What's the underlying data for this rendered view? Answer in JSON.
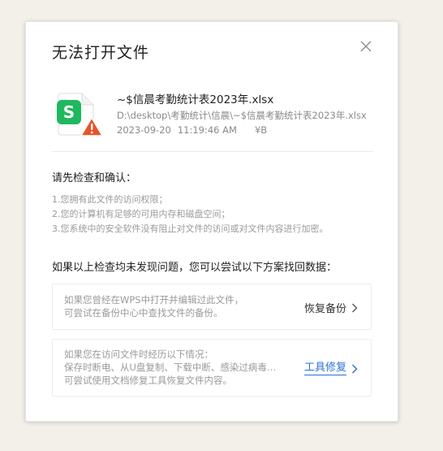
{
  "dialog": {
    "title": "无法打开文件"
  },
  "file": {
    "name": "~$信晨考勤统计表2023年.xlsx",
    "path": "D:\\desktop\\考勤统计\\信晨\\~$信晨考勤统计表2023年.xlsx",
    "date": "2023-09-20",
    "time": "11:19:46 AM",
    "size": "¥B",
    "app_letter": "S"
  },
  "checks": {
    "heading": "请先检查和确认：",
    "items": [
      "1.您拥有此文件的访问权限；",
      "2.您的计算机有足够的可用内存和磁盘空间；",
      "3.您系统中的安全软件没有阻止对文件的访问或对文件内容进行加密。"
    ]
  },
  "recovery": {
    "heading": "如果以上检查均未发现问题，您可以尝试以下方案找回数据：",
    "backup": {
      "line1": "如果您曾经在WPS中打开并编辑过此文件，",
      "line2": "可尝试在备份中心中查找文件的备份。",
      "action": "恢复备份"
    },
    "repair": {
      "line1": "如果您在访问文件时经历以下情况：",
      "line2": "保存时断电、从U盘复制、下载中断、感染过病毒、...",
      "line3": "可尝试使用文档修复工具恢复文件内容。",
      "action": "工具修复"
    }
  },
  "colors": {
    "link": "#2b6fd6",
    "wps_green": "#1fb85e",
    "warning": "#e8532a"
  }
}
